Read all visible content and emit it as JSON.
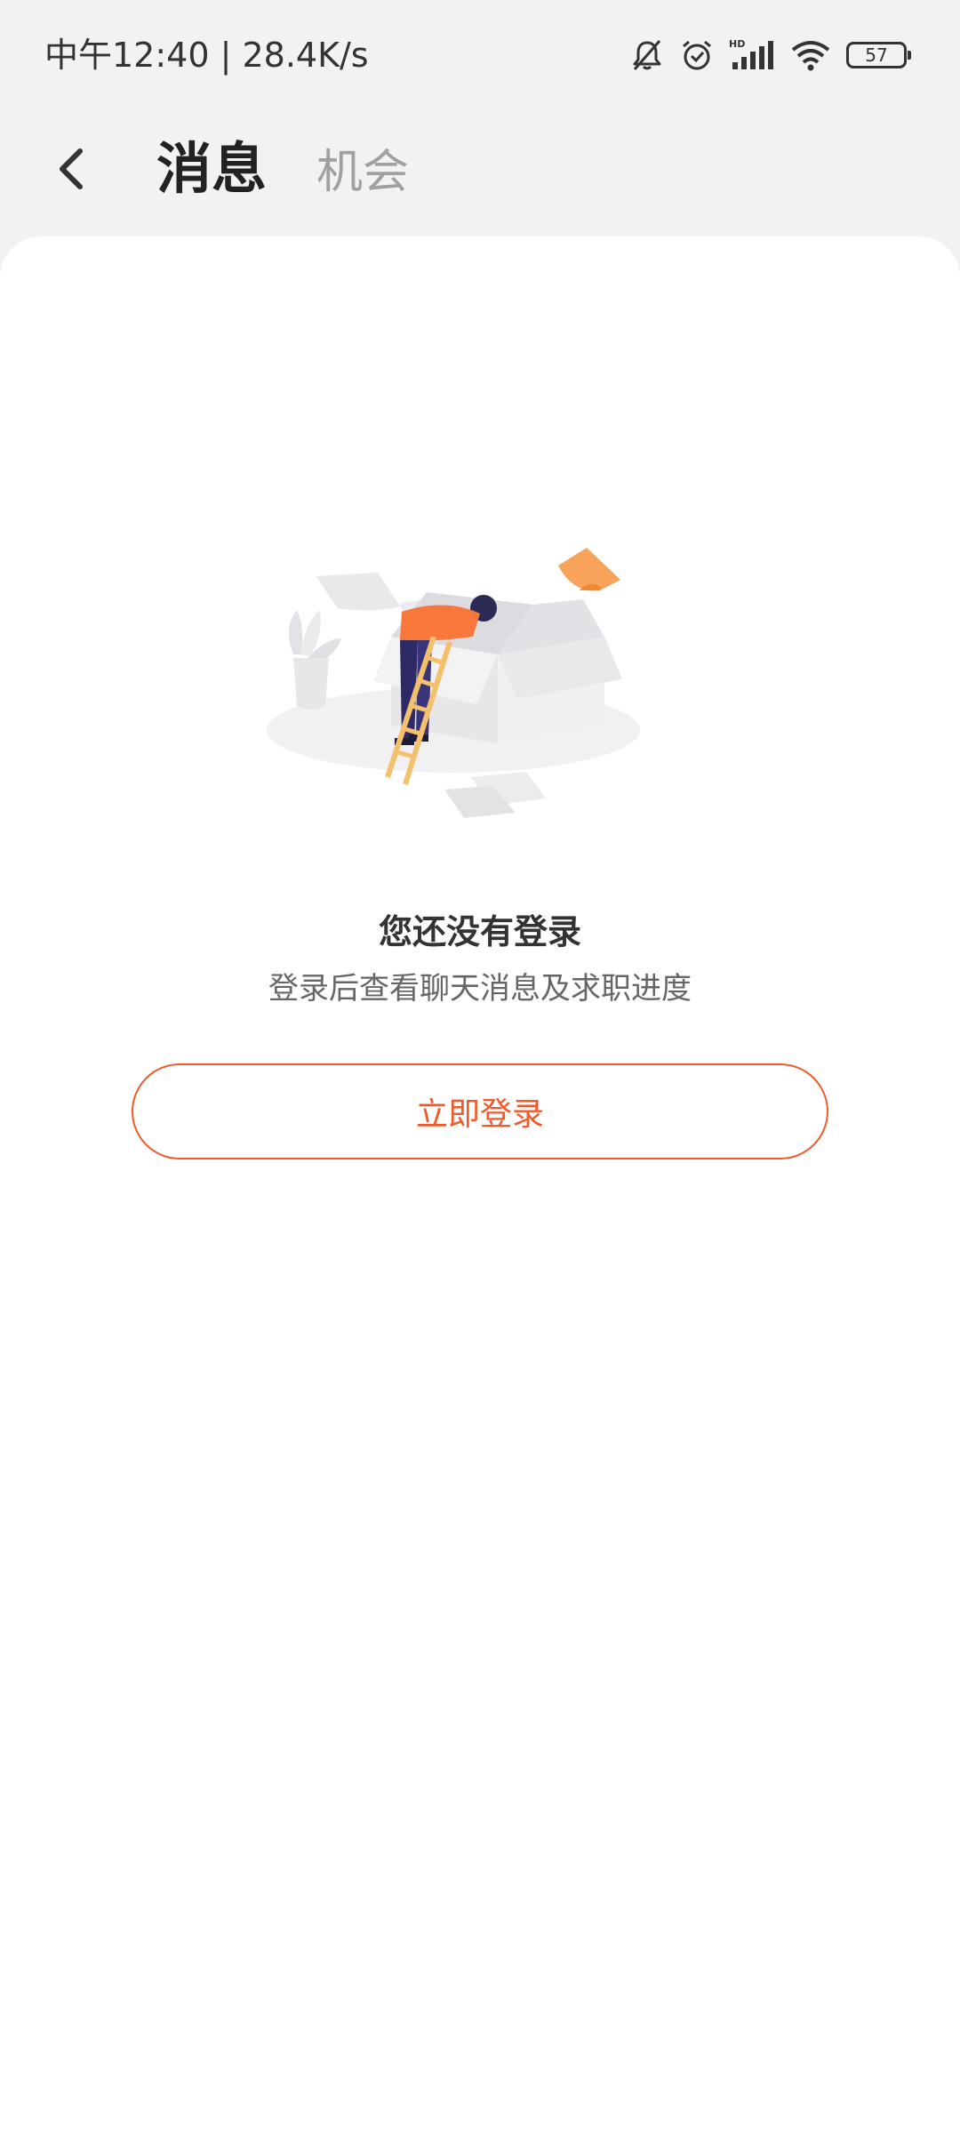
{
  "status_bar": {
    "time_speed": "中午12:40 | 28.4K/s",
    "battery_level": "57",
    "icons": [
      "bell-off-icon",
      "alarm-icon",
      "hd-signal-icon",
      "wifi-icon",
      "battery-icon"
    ]
  },
  "header": {
    "tabs": [
      {
        "label": "消息",
        "active": true
      },
      {
        "label": "机会",
        "active": false
      }
    ]
  },
  "empty_state": {
    "title": "您还没有登录",
    "subtitle": "登录后查看聊天消息及求职进度",
    "login_button_label": "立即登录"
  },
  "colors": {
    "accent": "#f05a2a",
    "background": "#f2f2f2",
    "card": "#ffffff",
    "inactive_tab": "#a0a0a0"
  }
}
